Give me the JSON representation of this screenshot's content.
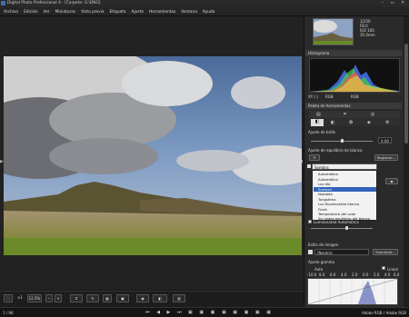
{
  "window": {
    "title": "Digital Photo Professional 4 - [Carpeta: G:\\DNG]",
    "controls": "‒ ▭ ✕"
  },
  "menu": [
    "Archivo",
    "Edición",
    "Ver",
    "Miniaturas",
    "Vista previa",
    "Etiqueta",
    "Ajuste",
    "Herramientas",
    "Ventana",
    "Ayuda"
  ],
  "info": {
    "exposure": "1/250",
    "f": "F8.0",
    "iso": "ISO 100",
    "focal": "35.0mm"
  },
  "histogram": {
    "title": "Histograma",
    "mode_a": "RGB",
    "mode_b": "RGB"
  },
  "palette": {
    "title": "Paleta de herramientas"
  },
  "brightness": {
    "label": "Ajuste de brillo",
    "value": "0.00",
    "level": 0.5
  },
  "wb": {
    "label": "Ajuste de equilibrio de blanco",
    "register_button": "Registrar...",
    "current": "Sombra"
  },
  "wb_options": [
    {
      "label": "Automático",
      "selected": false
    },
    {
      "label": "Automático",
      "selected": false
    },
    {
      "label": "Luz día",
      "selected": false
    },
    {
      "label": "Sombra",
      "selected": true
    },
    {
      "label": "Nublado",
      "selected": false
    },
    {
      "label": "Tungsteno",
      "selected": false
    },
    {
      "label": "Luz fluorescente blanca",
      "selected": false
    },
    {
      "label": "Flash",
      "selected": false
    },
    {
      "label": "Temperatura del color",
      "selected": false
    },
    {
      "label": "Sin datos equilibrio del blanco",
      "selected": false
    }
  ],
  "auto_light": {
    "label": "Luminosidad Automática"
  },
  "style": {
    "label": "Estilo de imagen",
    "value": "(Neutro)",
    "browse": "Examinar..."
  },
  "gamma": {
    "label": "Ajuste gamma",
    "auto": "Auto",
    "linear": "Lineal",
    "scale": [
      "-10.0",
      "8.0",
      "6.0",
      "4.0",
      "2.0",
      "0.0",
      "2.0",
      "4.0",
      "6.0"
    ]
  },
  "toolbar": {
    "zoom": "12.5%",
    "scale": "×1"
  },
  "status": {
    "left": "1 / 96",
    "right": "Adobe RGB / Adobe RGB"
  },
  "colors": {
    "accent": "#2f64b8",
    "panel": "#2a2a2a"
  }
}
